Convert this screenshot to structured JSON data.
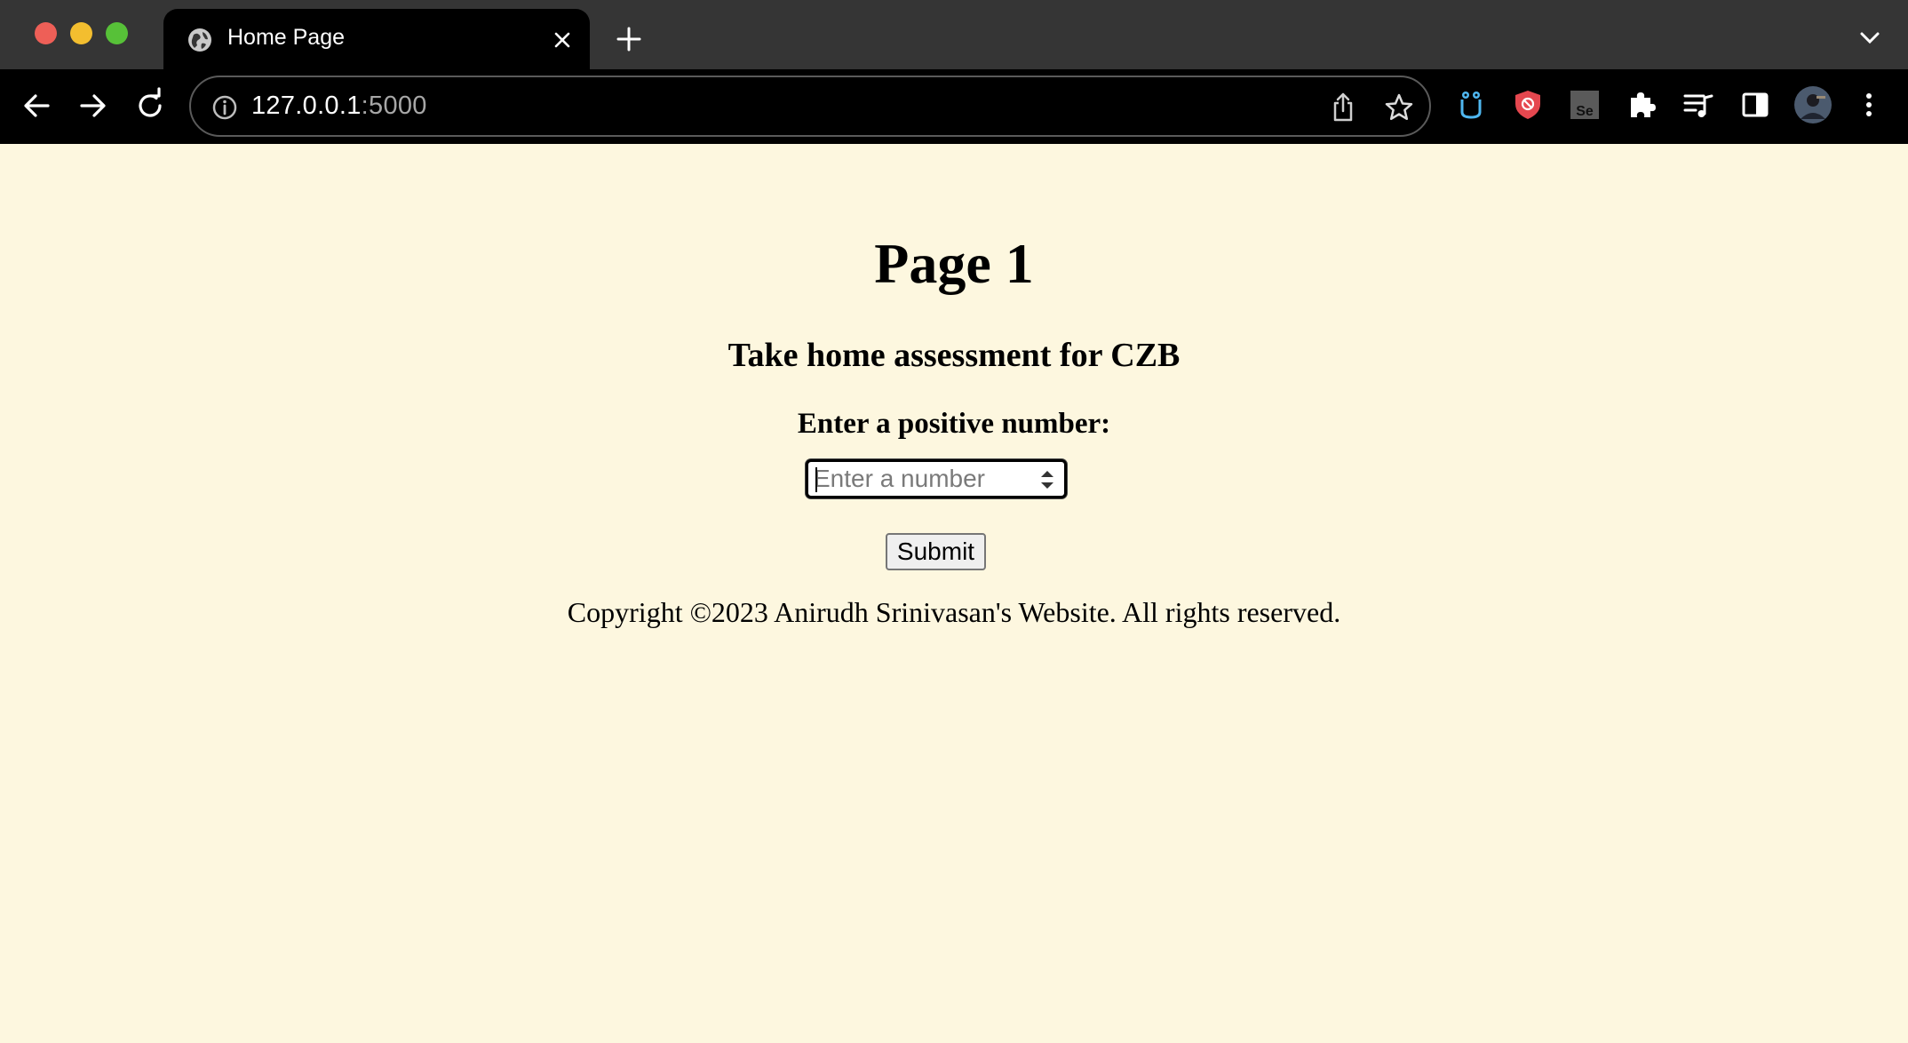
{
  "browser": {
    "tab": {
      "title": "Home Page",
      "favicon": "globe-icon"
    },
    "address": {
      "host": "127.0.0.1",
      "port": ":5000"
    },
    "icons": [
      "back-icon",
      "forward-icon",
      "reload-icon",
      "info-icon",
      "share-icon",
      "star-icon",
      "owl-extension-icon",
      "shield-extension-icon",
      "selenium-extension-icon",
      "puzzle-extensions-icon",
      "playlist-icon",
      "side-panel-icon",
      "avatar",
      "kebab-menu-icon"
    ]
  },
  "page": {
    "title": "Page 1",
    "subtitle": "Take home assessment for CZB",
    "input_label": "Enter a positive number:",
    "input": {
      "placeholder": "Enter a number",
      "value": ""
    },
    "submit_label": "Submit",
    "footer": "Copyright ©2023 Anirudh Srinivasan's Website. All rights reserved."
  },
  "colors": {
    "page_background": "#fdf7df",
    "toolbar": "#000000",
    "tabstrip": "#353535"
  }
}
